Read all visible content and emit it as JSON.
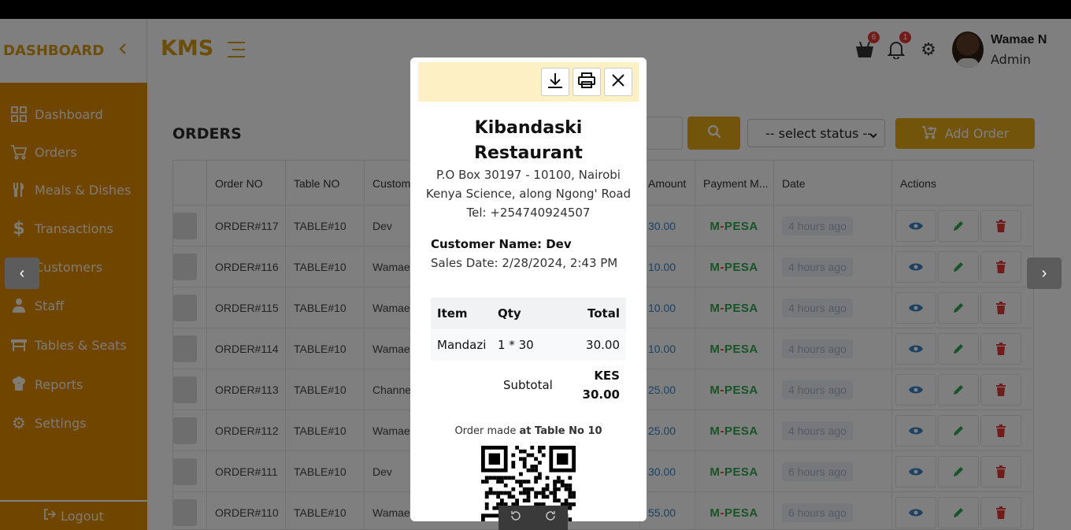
{
  "sidebar": {
    "title": "DASHBOARD",
    "items": [
      {
        "label": "Dashboard",
        "icon": "grid-icon"
      },
      {
        "label": "Orders",
        "icon": "cart-icon"
      },
      {
        "label": "Meals & Dishes",
        "icon": "utensils-icon"
      },
      {
        "label": "Transactions",
        "icon": "dollar-icon"
      },
      {
        "label": "Customers",
        "icon": "users-icon"
      },
      {
        "label": "Staff",
        "icon": "user-icon"
      },
      {
        "label": "Tables & Seats",
        "icon": "table-icon"
      },
      {
        "label": "Reports",
        "icon": "chef-icon"
      },
      {
        "label": "Settings",
        "icon": "gear-icon"
      }
    ],
    "logout_label": "Logout"
  },
  "header": {
    "brand": "KMS",
    "cart_count": "6",
    "notification_count": "1",
    "user_name": "Wamae N",
    "user_role": "Admin"
  },
  "main": {
    "page_title": "ORDERS",
    "status_select": "-- select status --",
    "add_order_label": "Add Order",
    "columns": [
      "Order NO",
      "Table NO",
      "Customer",
      "Amount",
      "Payment M...",
      "Date",
      "Actions"
    ],
    "rows": [
      {
        "order": "ORDER#117",
        "table": "TABLE#10",
        "customer": "Dev",
        "amount": "30.00",
        "payment": "M-PESA",
        "date": "4 hours ago"
      },
      {
        "order": "ORDER#116",
        "table": "TABLE#10",
        "customer": "Wamae",
        "amount": "10.00",
        "payment": "M-PESA",
        "date": "4 hours ago"
      },
      {
        "order": "ORDER#115",
        "table": "TABLE#10",
        "customer": "Wamae",
        "amount": "10.00",
        "payment": "M-PESA",
        "date": "4 hours ago"
      },
      {
        "order": "ORDER#114",
        "table": "TABLE#10",
        "customer": "Wamae",
        "amount": "10.00",
        "payment": "M-PESA",
        "date": "4 hours ago"
      },
      {
        "order": "ORDER#113",
        "table": "TABLE#10",
        "customer": "Channe",
        "amount": "25.00",
        "payment": "M-PESA",
        "date": "4 hours ago"
      },
      {
        "order": "ORDER#112",
        "table": "TABLE#10",
        "customer": "Wamae",
        "amount": "25.00",
        "payment": "M-PESA",
        "date": "4 hours ago"
      },
      {
        "order": "ORDER#111",
        "table": "TABLE#10",
        "customer": "Dev",
        "amount": "30.00",
        "payment": "M-PESA",
        "date": "6 hours ago"
      },
      {
        "order": "ORDER#110",
        "table": "TABLE#10",
        "customer": "Wamae",
        "amount": "55.00",
        "payment": "M-PESA",
        "date": "6 hours ago"
      }
    ]
  },
  "receipt": {
    "restaurant_line1": "Kibandaski",
    "restaurant_line2": "Restaurant",
    "address": "P.O Box 30197 - 10100, Nairobi",
    "location": "Kenya Science, along Ngong' Road",
    "tel": "Tel: +254740924507",
    "customer": "Customer Name: Dev",
    "sales_date": "Sales Date: 2/28/2024, 2:43 PM",
    "head_item": "Item",
    "head_qty": "Qty",
    "head_total": "Total",
    "item_name": "Mandazi",
    "item_qty": "1 * 30",
    "item_total": "30.00",
    "subtotal_label": "Subtotal",
    "subtotal_currency": "KES",
    "subtotal_value": "30.00",
    "note_prefix": "Order made ",
    "note_bold": "at Table No 10"
  },
  "colors": {
    "accent": "#e6a817",
    "sidebar": "#e08a00",
    "mpesa_green": "#2fa84f"
  }
}
